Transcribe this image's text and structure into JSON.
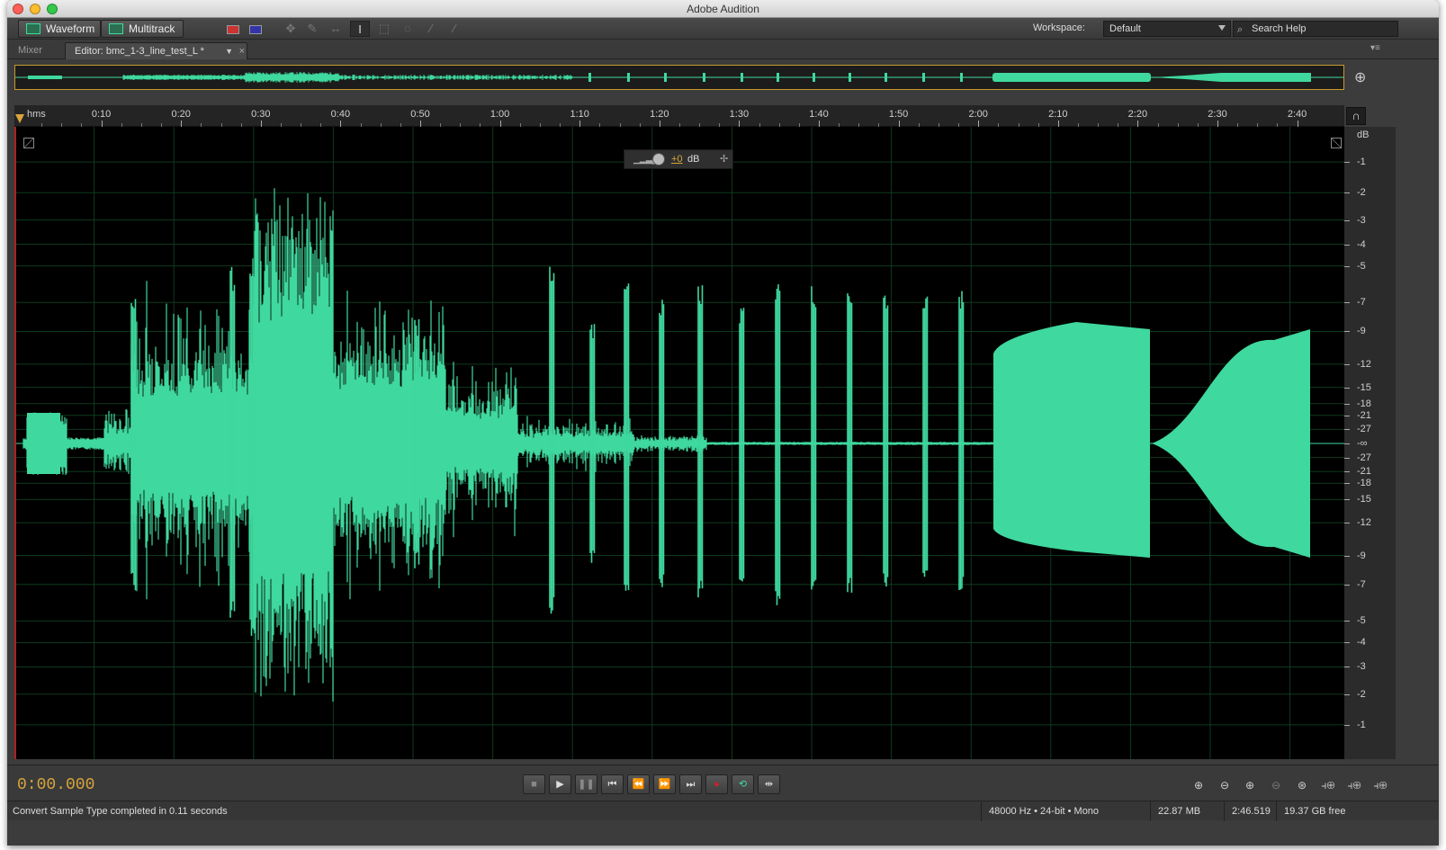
{
  "window": {
    "title": "Adobe Audition"
  },
  "toolbar": {
    "waveform_label": "Waveform",
    "multitrack_label": "Multitrack",
    "workspace_label": "Workspace:",
    "workspace_value": "Default",
    "search_placeholder": "Search Help"
  },
  "tabs": {
    "mixer": "Mixer",
    "editor": "Editor: bmc_1-3_line_test_L *"
  },
  "timeline": {
    "unit_label": "hms",
    "ticks": [
      "0:10",
      "0:20",
      "0:30",
      "0:40",
      "0:50",
      "1:00",
      "1:10",
      "1:20",
      "1:30",
      "1:40",
      "1:50",
      "2:00",
      "2:10",
      "2:20",
      "2:30",
      "2:40"
    ],
    "duration_seconds": 166.519,
    "playhead_seconds": 0
  },
  "db_scale": {
    "unit": "dB",
    "upper": [
      "-1",
      "-2",
      "-3",
      "-4",
      "-5",
      "-7",
      "-9",
      "-12",
      "-15",
      "-18",
      "-21",
      "-27"
    ],
    "center": "-∞",
    "lower": [
      "-27",
      "-21",
      "-18",
      "-15",
      "-12",
      "-9",
      "-7",
      "-5",
      "-4",
      "-3",
      "-2",
      "-1"
    ]
  },
  "hud": {
    "gain": "+0",
    "unit": "dB"
  },
  "transport": {
    "time": "0:00.000"
  },
  "status": {
    "message": "Convert Sample Type completed in 0.11 seconds",
    "format": "48000 Hz • 24-bit • Mono",
    "size": "22.87 MB",
    "duration": "2:46.519",
    "free": "19.37 GB free"
  },
  "colors": {
    "waveform": "#3fd89e",
    "accent": "#d8a53a",
    "background": "#000000"
  }
}
